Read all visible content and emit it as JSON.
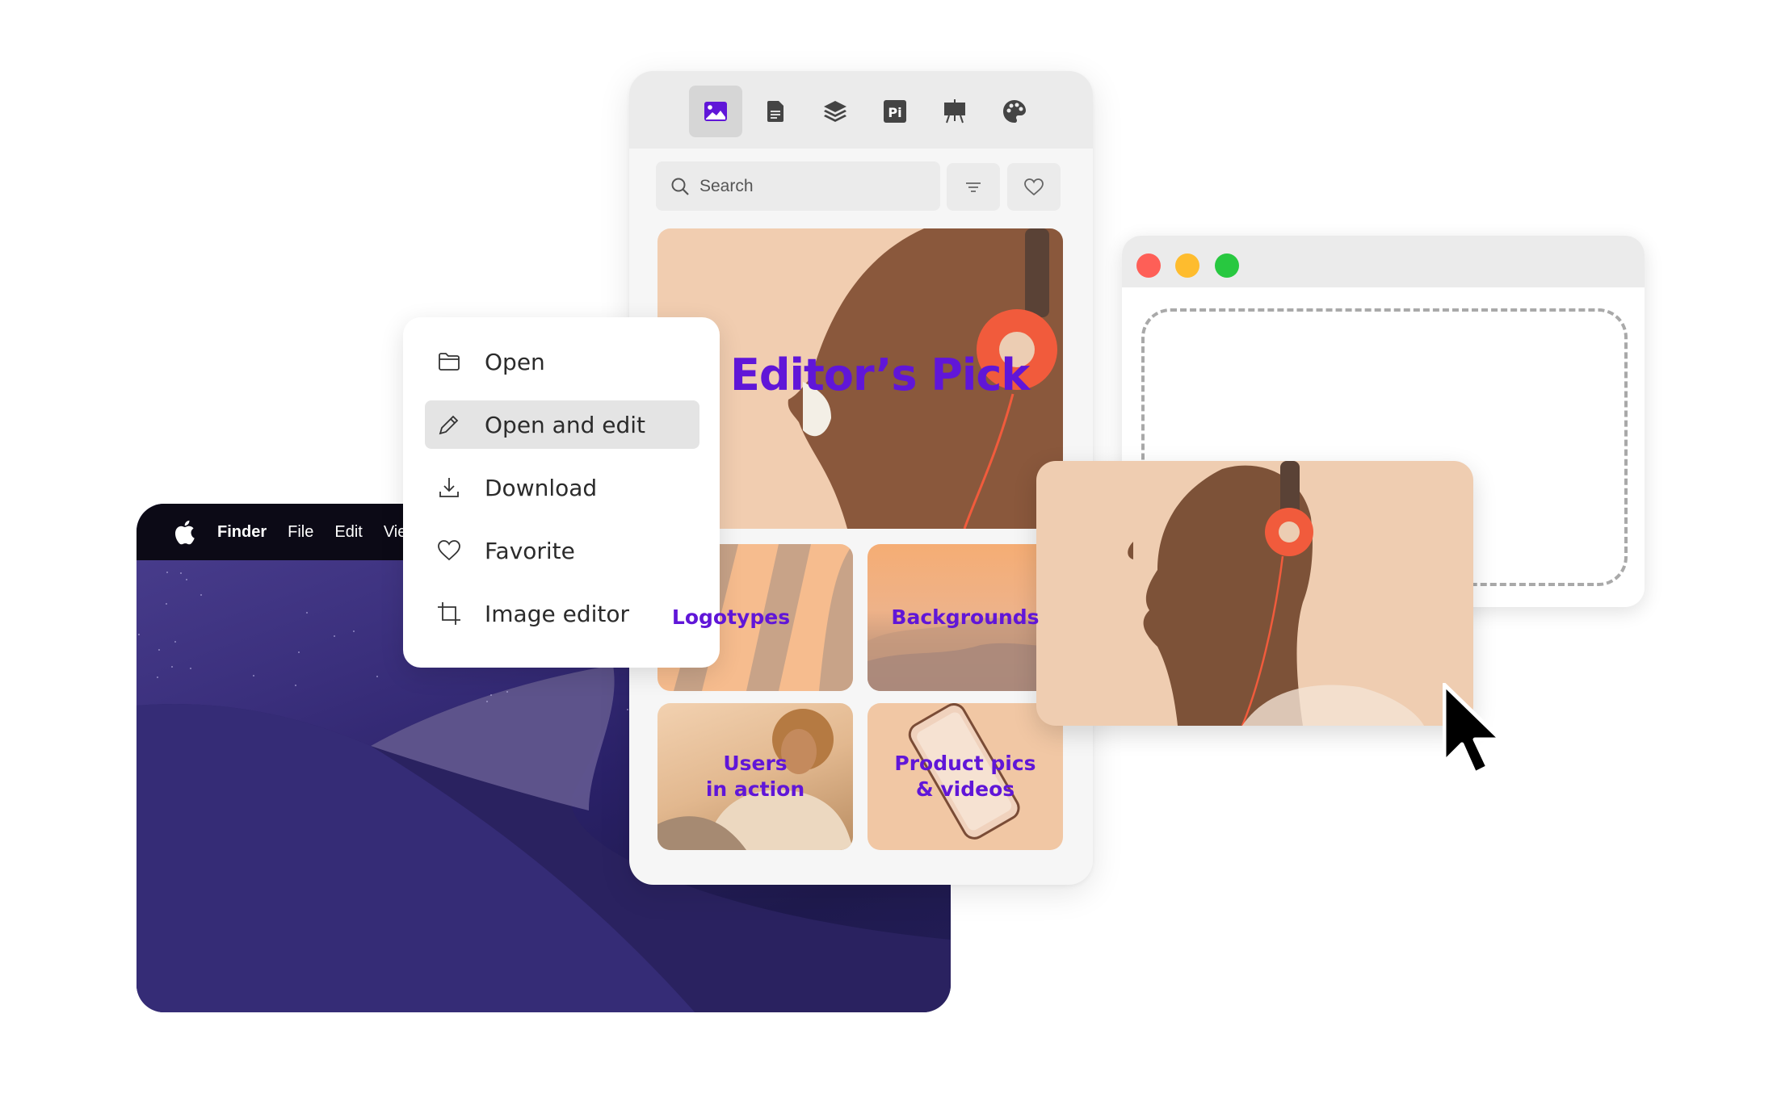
{
  "finder": {
    "menubar": {
      "apple_icon": "apple-logo-icon",
      "items": [
        "Finder",
        "File",
        "Edit",
        "Vie"
      ]
    }
  },
  "panel": {
    "tabs": [
      {
        "name": "images",
        "icon": "image-icon",
        "active": true
      },
      {
        "name": "documents",
        "icon": "document-icon",
        "active": false
      },
      {
        "name": "layers",
        "icon": "layers-icon",
        "active": false
      },
      {
        "name": "photoshop",
        "icon": "pi-icon",
        "label": "Pi",
        "active": false
      },
      {
        "name": "presentations",
        "icon": "easel-icon",
        "active": false
      },
      {
        "name": "colors",
        "icon": "palette-icon",
        "active": false
      }
    ],
    "search": {
      "placeholder": "Search",
      "icon": "search-icon"
    },
    "filter_icon": "filter-icon",
    "favorite_icon": "heart-icon",
    "hero": {
      "title": "Editor’s Pick"
    },
    "tiles": [
      {
        "label": "Logotypes",
        "visible_label": "ogotypes"
      },
      {
        "label": "Backgrounds"
      },
      {
        "label": "Users\nin action"
      },
      {
        "label": "Product pics\n& videos"
      }
    ]
  },
  "context_menu": {
    "items": [
      {
        "label": "Open",
        "icon": "folder-icon",
        "highlighted": false
      },
      {
        "label": "Open and edit",
        "icon": "pencil-icon",
        "highlighted": true
      },
      {
        "label": "Download",
        "icon": "download-icon",
        "highlighted": false
      },
      {
        "label": "Favorite",
        "icon": "heart-icon",
        "highlighted": false
      },
      {
        "label": "Image editor",
        "icon": "crop-icon",
        "highlighted": false
      }
    ]
  },
  "window": {
    "traffic_lights": {
      "close": "#fe5f57",
      "minimize": "#febc2e",
      "maximize": "#28c840"
    }
  },
  "colors": {
    "accent": "#6016d8",
    "tile_peach": "#f1cdb0",
    "menu_highlight": "#e4e4e4"
  }
}
